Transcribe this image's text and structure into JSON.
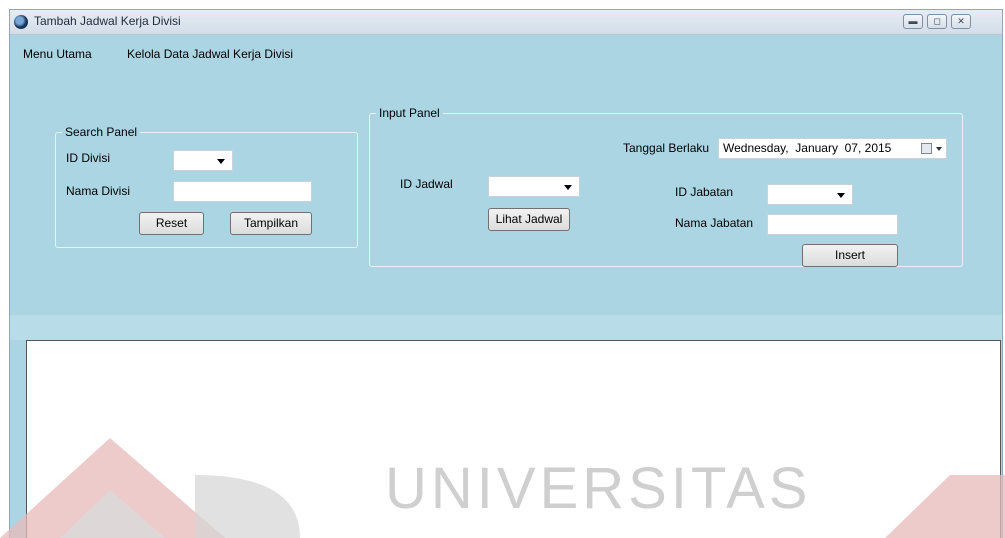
{
  "window": {
    "title": "Tambah Jadwal Kerja Divisi",
    "controls": [
      "minimize-icon",
      "maximize-icon",
      "close-icon"
    ]
  },
  "menu": [
    {
      "label": "Menu Utama"
    },
    {
      "label": "Kelola Data Jadwal Kerja Divisi"
    }
  ],
  "search_panel": {
    "legend": "Search Panel",
    "id_divisi_label": "ID Divisi",
    "id_divisi_value": "",
    "nama_divisi_label": "Nama Divisi",
    "nama_divisi_value": "",
    "reset_label": "Reset",
    "tampilkan_label": "Tampilkan"
  },
  "input_panel": {
    "legend": "Input Panel",
    "tanggal_berlaku_label": "Tanggal Berlaku",
    "tanggal_berlaku_value": "Wednesday,  January  07, 2015",
    "id_jadwal_label": "ID Jadwal",
    "id_jadwal_value": "",
    "lihat_jadwal_label": "Lihat Jadwal",
    "id_jabatan_label": "ID Jabatan",
    "id_jabatan_value": "",
    "nama_jabatan_label": "Nama Jabatan",
    "nama_jabatan_value": "",
    "insert_label": "Insert"
  },
  "watermark": {
    "text": "UNIVERSITAS"
  },
  "colors": {
    "form_background": "#abd5e3",
    "groupbox_border": "#e8f2f6",
    "watermark_red": "#e8b9b9"
  }
}
